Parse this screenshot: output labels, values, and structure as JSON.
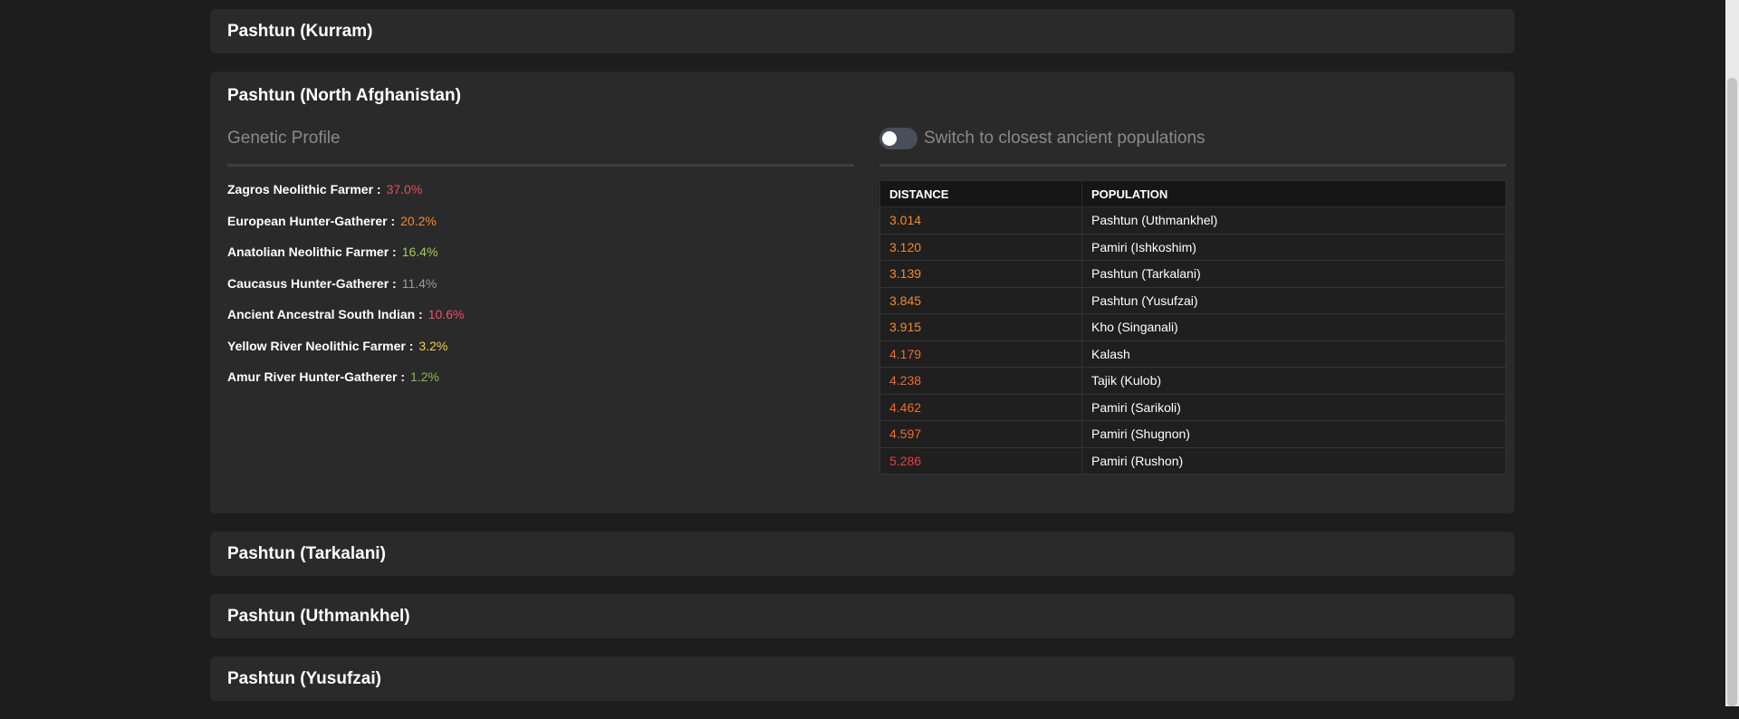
{
  "panels_before": [
    {
      "title": "Pashtun (Kurram)"
    }
  ],
  "expanded": {
    "title": "Pashtun (North Afghanistan)",
    "genetic_profile_heading": "Genetic Profile",
    "toggle_label": "Switch to closest ancient populations",
    "toggle_on": false,
    "profile": [
      {
        "label": "Zagros Neolithic Farmer :",
        "value": "37.0%",
        "color": "#e0505a"
      },
      {
        "label": "European Hunter-Gatherer :",
        "value": "20.2%",
        "color": "#f08a2a"
      },
      {
        "label": "Anatolian Neolithic Farmer :",
        "value": "16.4%",
        "color": "#a8cc5a"
      },
      {
        "label": "Caucasus Hunter-Gatherer :",
        "value": "11.4%",
        "color": "#9a9a9a"
      },
      {
        "label": "Ancient Ancestral South Indian :",
        "value": "10.6%",
        "color": "#f0506a"
      },
      {
        "label": "Yellow River Neolithic Farmer :",
        "value": "3.2%",
        "color": "#f0d04a"
      },
      {
        "label": "Amur River Hunter-Gatherer :",
        "value": "1.2%",
        "color": "#8ab84a"
      }
    ],
    "table": {
      "headers": [
        "DISTANCE",
        "POPULATION"
      ],
      "rows": [
        {
          "distance": "3.014",
          "population": "Pashtun (Uthmankhel)",
          "color": "#f08a2a"
        },
        {
          "distance": "3.120",
          "population": "Pamiri (Ishkoshim)",
          "color": "#f08a2a"
        },
        {
          "distance": "3.139",
          "population": "Pashtun (Tarkalani)",
          "color": "#f08a2a"
        },
        {
          "distance": "3.845",
          "population": "Pashtun (Yusufzai)",
          "color": "#f08a2a"
        },
        {
          "distance": "3.915",
          "population": "Kho (Singanali)",
          "color": "#f08a2a"
        },
        {
          "distance": "4.179",
          "population": "Kalash",
          "color": "#f06a2a"
        },
        {
          "distance": "4.238",
          "population": "Tajik (Kulob)",
          "color": "#f06a2a"
        },
        {
          "distance": "4.462",
          "population": "Pamiri (Sarikoli)",
          "color": "#f06a2a"
        },
        {
          "distance": "4.597",
          "population": "Pamiri (Shugnon)",
          "color": "#f06a2a"
        },
        {
          "distance": "5.286",
          "population": "Pamiri (Rushon)",
          "color": "#f03a3a"
        }
      ]
    }
  },
  "panels_after": [
    {
      "title": "Pashtun (Tarkalani)"
    },
    {
      "title": "Pashtun (Uthmankhel)"
    },
    {
      "title": "Pashtun (Yusufzai)"
    }
  ]
}
